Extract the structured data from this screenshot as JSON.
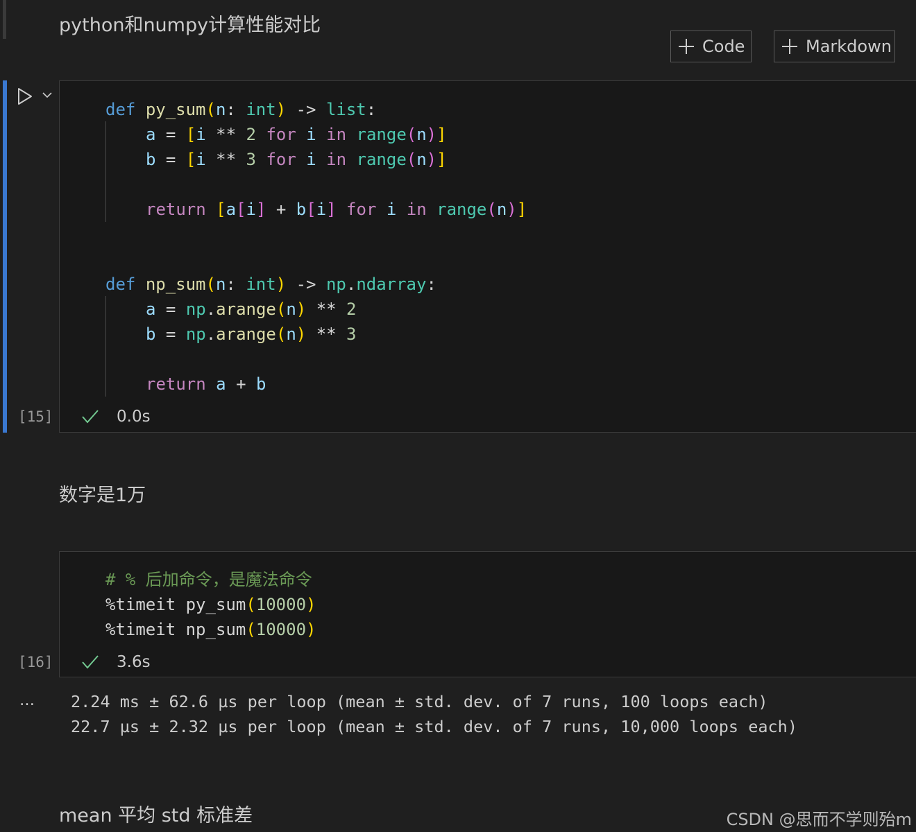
{
  "notebook": {
    "md1": "python和numpy计算性能对比",
    "md2": "数字是1万",
    "md3": "mean 平均 std 标准差",
    "toolbar": {
      "code_label": "Code",
      "markdown_label": "Markdown"
    },
    "cell1": {
      "exec_count": "[15]",
      "duration": "0.0s",
      "status": "success"
    },
    "cell2": {
      "exec_count": "[16]",
      "duration": "3.6s",
      "status": "success",
      "output_ellipsis": "…",
      "output": [
        "2.24 ms ± 62.6 µs per loop (mean ± std. dev. of 7 runs, 100 loops each)",
        "22.7 µs ± 2.32 µs per loop (mean ± std. dev. of 7 runs, 10,000 loops each)"
      ]
    },
    "watermark": "CSDN @思而不学则殆m"
  },
  "code": {
    "c1l1": [
      "def",
      "py_sum",
      "(",
      "n",
      ":",
      "int",
      ")",
      "->",
      "list",
      ":"
    ],
    "c1l2": [
      "a",
      "=",
      "[",
      "i",
      "**",
      "2",
      "for",
      "i",
      "in",
      "range",
      "(",
      "n",
      ")",
      "]"
    ],
    "c1l3": [
      "b",
      "=",
      "[",
      "i",
      "**",
      "3",
      "for",
      "i",
      "in",
      "range",
      "(",
      "n",
      ")",
      "]"
    ],
    "c1l4": [
      "return",
      "[",
      "a",
      "[",
      "i",
      "]",
      "+",
      "b",
      "[",
      "i",
      "]",
      "for",
      "i",
      "in",
      "range",
      "(",
      "n",
      ")",
      "]"
    ],
    "c1l5": [
      "def",
      "np_sum",
      "(",
      "n",
      ":",
      "int",
      ")",
      "->",
      "np",
      ".",
      "ndarray",
      ":"
    ],
    "c1l6": [
      "a",
      "=",
      "np",
      ".",
      "arange",
      "(",
      "n",
      ")",
      "**",
      "2"
    ],
    "c1l7": [
      "b",
      "=",
      "np",
      ".",
      "arange",
      "(",
      "n",
      ")",
      "**",
      "3"
    ],
    "c1l8": [
      "return",
      "a",
      "+",
      "b"
    ],
    "c2l1": "# % 后加命令，是魔法命令",
    "c2l2": [
      "%timeit",
      "py_sum",
      "(",
      "10000",
      ")"
    ],
    "c2l3": [
      "%timeit",
      "np_sum",
      "(",
      "10000",
      ")"
    ]
  },
  "colors": {
    "accent": "#3a78d0",
    "success": "#73c991",
    "keyword": "#569cd6",
    "control": "#c586c0",
    "function": "#dcdcaa",
    "variable": "#9cdcfe",
    "type": "#4ec9b0",
    "number": "#b5cea8",
    "comment": "#6a9955"
  }
}
